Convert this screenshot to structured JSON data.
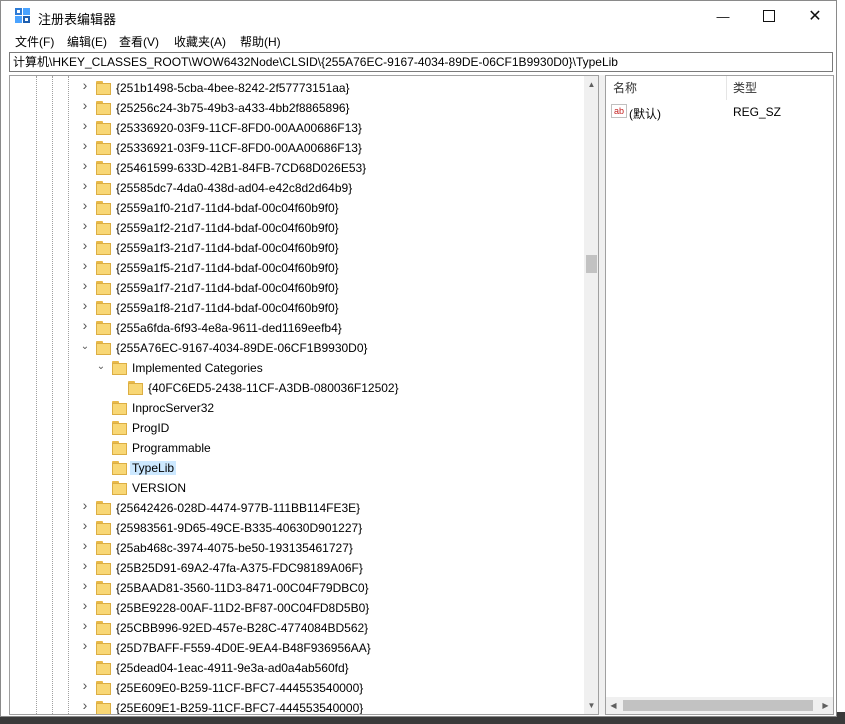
{
  "title": "注册表编辑器",
  "window_buttons": {
    "minimize": "—",
    "close": "✕"
  },
  "menu": [
    "文件(F)",
    "编辑(E)",
    "查看(V)",
    "收藏夹(A)",
    "帮助(H)"
  ],
  "address": "计算机\\HKEY_CLASSES_ROOT\\WOW6432Node\\CLSID\\{255A76EC-9167-4034-89DE-06CF1B9930D0}\\TypeLib",
  "tree": [
    {
      "label": "{251b1498-5cba-4bee-8242-2f57773151aa}",
      "level": 0,
      "expander": "collapsed"
    },
    {
      "label": "{25256c24-3b75-49b3-a433-4bb2f8865896}",
      "level": 0,
      "expander": "collapsed"
    },
    {
      "label": "{25336920-03F9-11CF-8FD0-00AA00686F13}",
      "level": 0,
      "expander": "collapsed"
    },
    {
      "label": "{25336921-03F9-11CF-8FD0-00AA00686F13}",
      "level": 0,
      "expander": "collapsed"
    },
    {
      "label": "{25461599-633D-42B1-84FB-7CD68D026E53}",
      "level": 0,
      "expander": "collapsed"
    },
    {
      "label": "{25585dc7-4da0-438d-ad04-e42c8d2d64b9}",
      "level": 0,
      "expander": "collapsed"
    },
    {
      "label": "{2559a1f0-21d7-11d4-bdaf-00c04f60b9f0}",
      "level": 0,
      "expander": "collapsed"
    },
    {
      "label": "{2559a1f2-21d7-11d4-bdaf-00c04f60b9f0}",
      "level": 0,
      "expander": "collapsed"
    },
    {
      "label": "{2559a1f3-21d7-11d4-bdaf-00c04f60b9f0}",
      "level": 0,
      "expander": "collapsed"
    },
    {
      "label": "{2559a1f5-21d7-11d4-bdaf-00c04f60b9f0}",
      "level": 0,
      "expander": "collapsed"
    },
    {
      "label": "{2559a1f7-21d7-11d4-bdaf-00c04f60b9f0}",
      "level": 0,
      "expander": "collapsed"
    },
    {
      "label": "{2559a1f8-21d7-11d4-bdaf-00c04f60b9f0}",
      "level": 0,
      "expander": "collapsed"
    },
    {
      "label": "{255a6fda-6f93-4e8a-9611-ded1169eefb4}",
      "level": 0,
      "expander": "collapsed"
    },
    {
      "label": "{255A76EC-9167-4034-89DE-06CF1B9930D0}",
      "level": 0,
      "expander": "expanded"
    },
    {
      "label": "Implemented Categories",
      "level": 1,
      "expander": "expanded"
    },
    {
      "label": "{40FC6ED5-2438-11CF-A3DB-080036F12502}",
      "level": 2,
      "expander": "none"
    },
    {
      "label": "InprocServer32",
      "level": 1,
      "expander": "none"
    },
    {
      "label": "ProgID",
      "level": 1,
      "expander": "none"
    },
    {
      "label": "Programmable",
      "level": 1,
      "expander": "none"
    },
    {
      "label": "TypeLib",
      "level": 1,
      "expander": "none",
      "selected": true
    },
    {
      "label": "VERSION",
      "level": 1,
      "expander": "none"
    },
    {
      "label": "{25642426-028D-4474-977B-111BB114FE3E}",
      "level": 0,
      "expander": "collapsed"
    },
    {
      "label": "{25983561-9D65-49CE-B335-40630D901227}",
      "level": 0,
      "expander": "collapsed"
    },
    {
      "label": "{25ab468c-3974-4075-be50-193135461727}",
      "level": 0,
      "expander": "collapsed"
    },
    {
      "label": "{25B25D91-69A2-47fa-A375-FDC98189A06F}",
      "level": 0,
      "expander": "collapsed"
    },
    {
      "label": "{25BAAD81-3560-11D3-8471-00C04F79DBC0}",
      "level": 0,
      "expander": "collapsed"
    },
    {
      "label": "{25BE9228-00AF-11D2-BF87-00C04FD8D5B0}",
      "level": 0,
      "expander": "collapsed"
    },
    {
      "label": "{25CBB996-92ED-457e-B28C-4774084BD562}",
      "level": 0,
      "expander": "collapsed"
    },
    {
      "label": "{25D7BAFF-F559-4D0E-9EA4-B48F936956AA}",
      "level": 0,
      "expander": "collapsed"
    },
    {
      "label": "{25dead04-1eac-4911-9e3a-ad0a4ab560fd}",
      "level": 0,
      "expander": "none"
    },
    {
      "label": "{25E609E0-B259-11CF-BFC7-444553540000}",
      "level": 0,
      "expander": "collapsed"
    },
    {
      "label": "{25E609E1-B259-11CF-BFC7-444553540000}",
      "level": 0,
      "expander": "collapsed"
    }
  ],
  "list": {
    "columns": [
      "名称",
      "类型"
    ],
    "rows": [
      {
        "icon": "ab",
        "name": "(默认)",
        "type": "REG_SZ"
      }
    ]
  },
  "icons": {
    "app": "registry-editor-icon",
    "folder": "folder-icon",
    "string_value": "string-value-icon"
  },
  "colors": {
    "selection": "#cce8ff",
    "folder": "#f8d775",
    "value_icon": "#c42121"
  }
}
